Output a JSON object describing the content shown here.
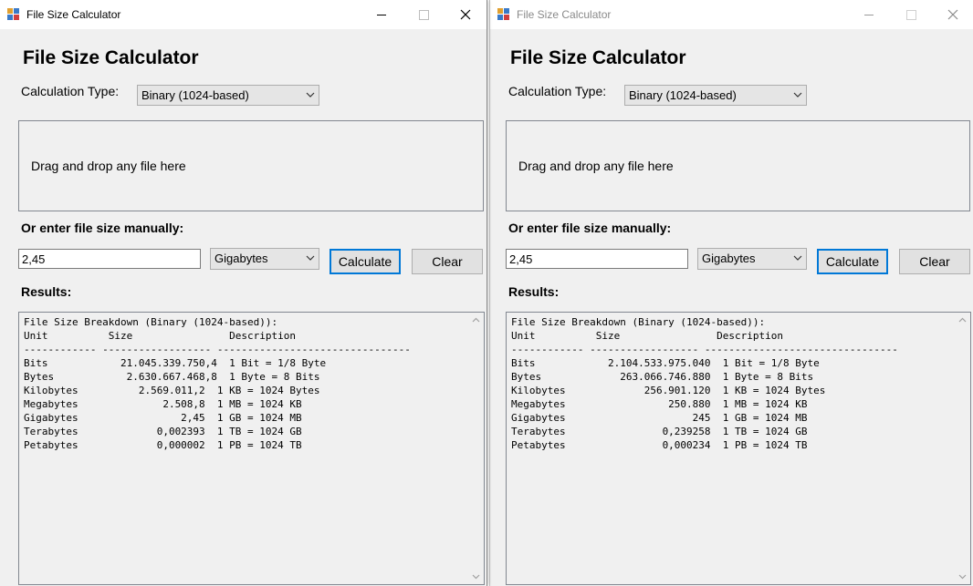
{
  "windows": [
    {
      "title": "File Size Calculator",
      "heading": "File Size Calculator",
      "calc_type_label": "Calculation Type:",
      "calc_type_value": "Binary (1024-based)",
      "drop_zone_text": "Drag and drop any file here",
      "manual_label": "Or enter file size manually:",
      "size_input_value": "2,45",
      "unit_value": "Gigabytes",
      "calculate_label": "Calculate",
      "clear_label": "Clear",
      "results_label": "Results:",
      "results_lines": [
        "File Size Breakdown (Binary (1024-based)):",
        "Unit          Size                Description",
        "------------ ------------------ --------------------------------",
        "Bits            21.045.339.750,4  1 Bit = 1/8 Byte",
        "Bytes            2.630.667.468,8  1 Byte = 8 Bits",
        "Kilobytes          2.569.011,2  1 KB = 1024 Bytes",
        "Megabytes              2.508,8  1 MB = 1024 KB",
        "Gigabytes                 2,45  1 GB = 1024 MB",
        "Terabytes             0,002393  1 TB = 1024 GB",
        "Petabytes             0,000002  1 PB = 1024 TB"
      ]
    },
    {
      "title": "File Size Calculator",
      "heading": "File Size Calculator",
      "calc_type_label": "Calculation Type:",
      "calc_type_value": "Binary (1024-based)",
      "drop_zone_text": "Drag and drop any file here",
      "manual_label": "Or enter file size manually:",
      "size_input_value": "2,45",
      "unit_value": "Gigabytes",
      "calculate_label": "Calculate",
      "clear_label": "Clear",
      "results_label": "Results:",
      "results_lines": [
        "File Size Breakdown (Binary (1024-based)):",
        "Unit          Size                Description",
        "------------ ------------------ --------------------------------",
        "Bits            2.104.533.975.040  1 Bit = 1/8 Byte",
        "Bytes             263.066.746.880  1 Byte = 8 Bits",
        "Kilobytes             256.901.120  1 KB = 1024 Bytes",
        "Megabytes                 250.880  1 MB = 1024 KB",
        "Gigabytes                     245  1 GB = 1024 MB",
        "Terabytes                0,239258  1 TB = 1024 GB",
        "Petabytes                0,000234  1 PB = 1024 TB"
      ]
    }
  ],
  "colors": {
    "window_bg": "#f0f0f0",
    "titlebar_bg": "#ffffff",
    "focus_accent": "#0078d7",
    "inactive_title": "#8a8a8a"
  },
  "icons": [
    "app-icon",
    "minimize-icon",
    "maximize-icon",
    "close-icon",
    "chevron-down-icon",
    "scroll-up-icon",
    "scroll-down-icon"
  ]
}
